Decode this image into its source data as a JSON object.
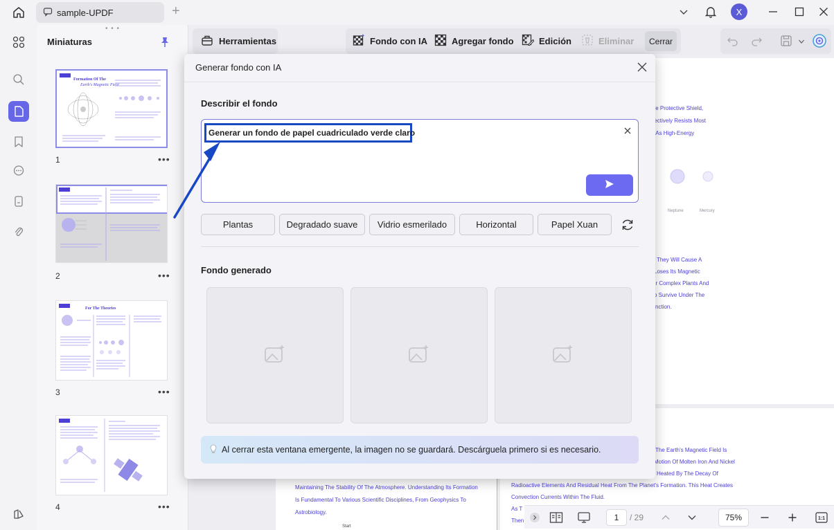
{
  "titlebar": {
    "tab_title": "sample-UPDF",
    "avatar_letter": "X"
  },
  "thumbnails": {
    "title": "Miniaturas",
    "pages": [
      {
        "number": "1",
        "heading": "Formation Of The Earth's Magnetic Field"
      },
      {
        "number": "2"
      },
      {
        "number": "3",
        "heading": "For The Theories"
      },
      {
        "number": "4"
      }
    ],
    "more": "•••"
  },
  "toolbar": {
    "tools_label": "Herramientas",
    "ai_bg_label": "Fondo con IA",
    "add_bg_label": "Agregar fondo",
    "edit_label": "Edición",
    "delete_label": "Eliminar",
    "close_label": "Cerrar"
  },
  "dialog": {
    "title": "Generar fondo con IA",
    "describe_label": "Describir el fondo",
    "prompt_value": "Generar un fondo de papel cuadriculado verde claro",
    "chips": [
      "Plantas",
      "Degradado suave",
      "Vidrio esmerilado",
      "Horizontal",
      "Papel Xuan"
    ],
    "generated_label": "Fondo generado",
    "notice": "Al cerrar esta ventana emergente, la imagen no se guardará. Descárguela primero si es necesario."
  },
  "document": {
    "right_lines_top": [
      "ble Protective Shield,",
      "ffectively Resists Most",
      "n As High-Energy"
    ],
    "planet_labels": [
      "Neptune",
      "Mercury"
    ],
    "right_lines_mid": [
      "They Will Cause A",
      "Loses Its Magnetic",
      "er Complex Plants And",
      "o Survive Under The",
      "tinction."
    ],
    "lower_right_lines": [
      "The Earth's Magnetic Field Is",
      "Motion Of Molten Iron And Nickel",
      "Heated By The Decay Of",
      "Radioactive Elements And Residual Heat From The Planet's Formation. This Heat Creates",
      "Convection Currents Within The Fluid.",
      "As T",
      "Then"
    ],
    "lower_left_lines": [
      "Maintaining The Stability Of The Atmosphere. Understanding Its Formation",
      "Is Fundamental To Various Scientific Disciplines, From Geophysics To",
      "Astrobiology."
    ],
    "lower_left_footer": "Start"
  },
  "statusbar": {
    "page_current": "1",
    "page_total": "/ 29",
    "zoom": "75%"
  },
  "colors": {
    "accent": "#6b6af0",
    "annotation": "#1847c4",
    "doc_text": "#4b3fd6"
  }
}
